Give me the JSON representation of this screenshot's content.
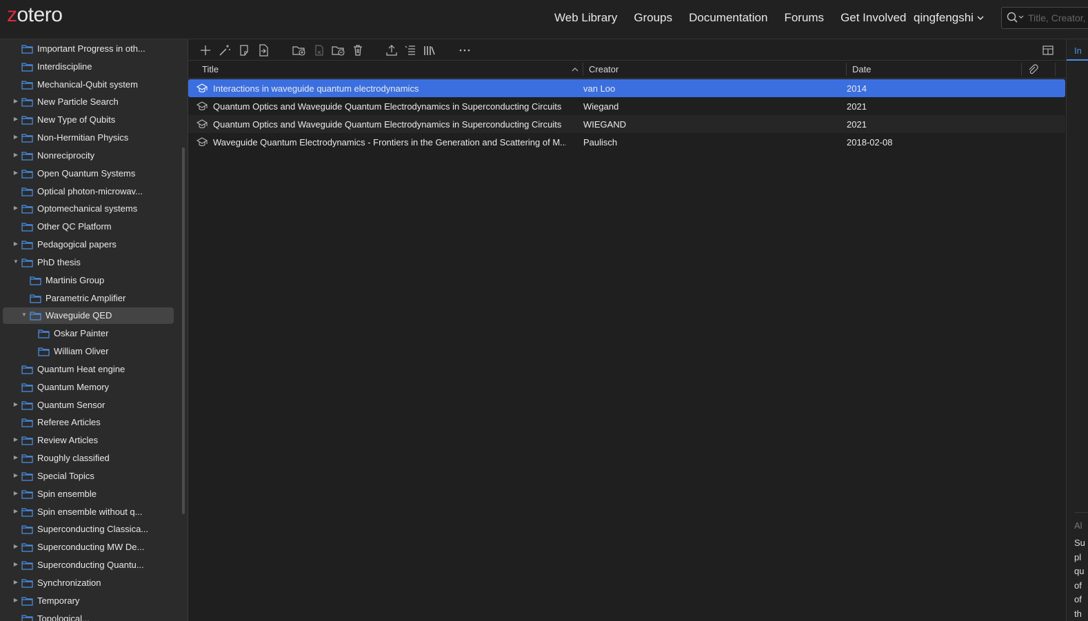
{
  "header": {
    "logo": "zotero",
    "nav": [
      "Web Library",
      "Groups",
      "Documentation",
      "Forums",
      "Get Involved"
    ],
    "user": "qingfengshi",
    "search_placeholder": "Title, Creator, Year"
  },
  "sidebar": {
    "items": [
      {
        "label": "Important Progress in oth...",
        "level": 0,
        "twisty": ""
      },
      {
        "label": "Interdiscipline",
        "level": 0,
        "twisty": ""
      },
      {
        "label": "Mechanical-Qubit system",
        "level": 0,
        "twisty": ""
      },
      {
        "label": "New Particle Search",
        "level": 0,
        "twisty": "▶"
      },
      {
        "label": "New Type of Qubits",
        "level": 0,
        "twisty": "▶"
      },
      {
        "label": "Non-Hermitian Physics",
        "level": 0,
        "twisty": "▶"
      },
      {
        "label": "Nonreciprocity",
        "level": 0,
        "twisty": "▶"
      },
      {
        "label": "Open Quantum Systems",
        "level": 0,
        "twisty": "▶"
      },
      {
        "label": "Optical photon-microwav...",
        "level": 0,
        "twisty": ""
      },
      {
        "label": "Optomechanical systems",
        "level": 0,
        "twisty": "▶"
      },
      {
        "label": "Other QC Platform",
        "level": 0,
        "twisty": ""
      },
      {
        "label": "Pedagogical papers",
        "level": 0,
        "twisty": "▶"
      },
      {
        "label": "PhD thesis",
        "level": 0,
        "twisty": "▼"
      },
      {
        "label": "Martinis Group",
        "level": 1,
        "twisty": ""
      },
      {
        "label": "Parametric Amplifier",
        "level": 1,
        "twisty": ""
      },
      {
        "label": "Waveguide QED",
        "level": 1,
        "twisty": "▼",
        "selected": true
      },
      {
        "label": "Oskar Painter",
        "level": 2,
        "twisty": ""
      },
      {
        "label": "William Oliver",
        "level": 2,
        "twisty": ""
      },
      {
        "label": "Quantum Heat engine",
        "level": 0,
        "twisty": ""
      },
      {
        "label": "Quantum Memory",
        "level": 0,
        "twisty": ""
      },
      {
        "label": "Quantum Sensor",
        "level": 0,
        "twisty": "▶"
      },
      {
        "label": "Referee Articles",
        "level": 0,
        "twisty": ""
      },
      {
        "label": "Review Articles",
        "level": 0,
        "twisty": "▶"
      },
      {
        "label": "Roughly classified",
        "level": 0,
        "twisty": "▶"
      },
      {
        "label": "Special Topics",
        "level": 0,
        "twisty": "▶"
      },
      {
        "label": "Spin ensemble",
        "level": 0,
        "twisty": "▶"
      },
      {
        "label": "Spin ensemble without q...",
        "level": 0,
        "twisty": "▶"
      },
      {
        "label": "Superconducting Classica...",
        "level": 0,
        "twisty": ""
      },
      {
        "label": "Superconducting MW De...",
        "level": 0,
        "twisty": "▶"
      },
      {
        "label": "Superconducting Quantu...",
        "level": 0,
        "twisty": "▶"
      },
      {
        "label": "Synchronization",
        "level": 0,
        "twisty": "▶"
      },
      {
        "label": "Temporary",
        "level": 0,
        "twisty": "▶"
      },
      {
        "label": "Topological...",
        "level": 0,
        "twisty": ""
      }
    ]
  },
  "toolbar": {
    "icons": [
      "plus-icon",
      "magic-wand-icon",
      "note-icon",
      "import-icon",
      "new-subcollection-icon",
      "remove-from-collection-icon",
      "move-to-trash-folder-icon",
      "trash-icon",
      "export-icon",
      "citation-icon",
      "bibliography-icon",
      "more-icon",
      "toggle-item-pane-icon"
    ]
  },
  "columns": {
    "title": "Title",
    "creator": "Creator",
    "date": "Date",
    "attachment_icon": "paperclip-icon"
  },
  "items": [
    {
      "title": "Interactions in waveguide quantum electrodynamics",
      "creator": "van Loo",
      "date": "2014",
      "selected": true
    },
    {
      "title": "Quantum Optics and Waveguide Quantum Electrodynamics in Superconducting Circuits",
      "creator": "Wiegand",
      "date": "2021"
    },
    {
      "title": "Quantum Optics and Waveguide Quantum Electrodynamics in Superconducting Circuits",
      "creator": "WIEGAND",
      "date": "2021"
    },
    {
      "title": "Waveguide Quantum Electrodynamics - Frontiers in the Generation and Scattering of M...",
      "creator": "Paulisch",
      "date": "2018-02-08"
    }
  ],
  "item_icon": "thesis-icon",
  "right_pane": {
    "tab": "In",
    "section_label": "Al",
    "abstract_lines": [
      "Su",
      "pl",
      "qu",
      "of",
      "of",
      "th"
    ]
  },
  "colors": {
    "accent": "#3b6fe0",
    "logo_z": "#db2c3a",
    "folder": "#4a90e8",
    "background": "#1f1f1f",
    "sidebar": "#2b2b2b"
  }
}
